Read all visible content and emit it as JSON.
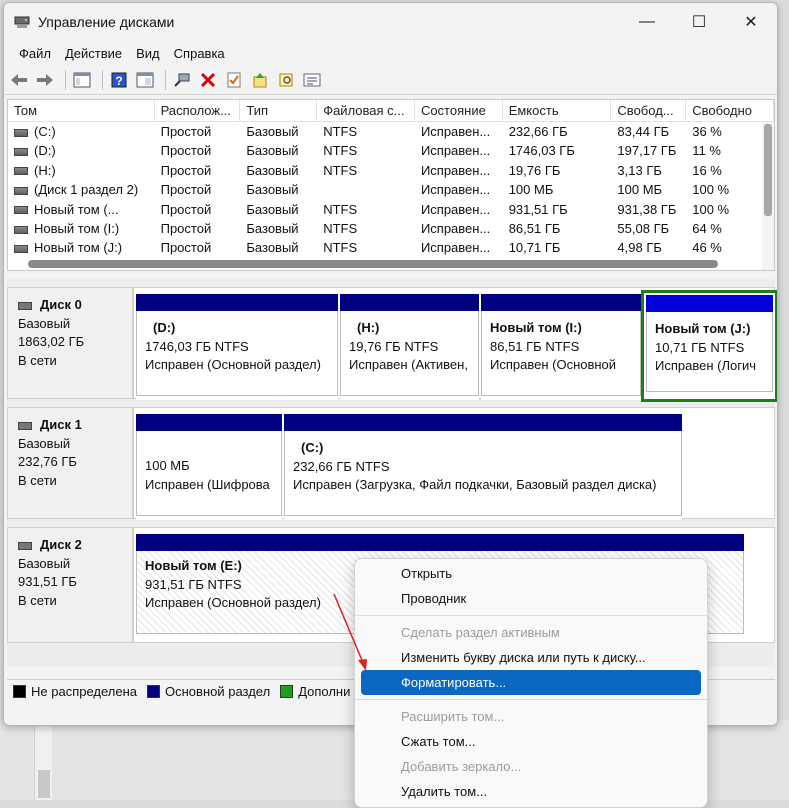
{
  "window": {
    "title": "Управление дисками"
  },
  "menu": [
    "Файл",
    "Действие",
    "Вид",
    "Справка"
  ],
  "columns": [
    "Том",
    "Располож...",
    "Тип",
    "Файловая с...",
    "Состояние",
    "Емкость",
    "Свобод...",
    "Свободно"
  ],
  "volumes": [
    [
      "(C:)",
      "Простой",
      "Базовый",
      "NTFS",
      "Исправен...",
      "232,66 ГБ",
      "83,44 ГБ",
      "36 %"
    ],
    [
      "(D:)",
      "Простой",
      "Базовый",
      "NTFS",
      "Исправен...",
      "1746,03 ГБ",
      "197,17 ГБ",
      "11 %"
    ],
    [
      "(H:)",
      "Простой",
      "Базовый",
      "NTFS",
      "Исправен...",
      "19,76 ГБ",
      "3,13 ГБ",
      "16 %"
    ],
    [
      "(Диск 1 раздел 2)",
      "Простой",
      "Базовый",
      "",
      "Исправен...",
      "100 МБ",
      "100 МБ",
      "100 %"
    ],
    [
      "Новый том (...",
      "Простой",
      "Базовый",
      "NTFS",
      "Исправен...",
      "931,51 ГБ",
      "931,38 ГБ",
      "100 %"
    ],
    [
      "Новый том (I:)",
      "Простой",
      "Базовый",
      "NTFS",
      "Исправен...",
      "86,51 ГБ",
      "55,08 ГБ",
      "64 %"
    ],
    [
      "Новый том (J:)",
      "Простой",
      "Базовый",
      "NTFS",
      "Исправен...",
      "10,71 ГБ",
      "4,98 ГБ",
      "46 %"
    ]
  ],
  "disks": [
    {
      "name": "Диск 0",
      "type": "Базовый",
      "size": "1863,02 ГБ",
      "status": "В сети",
      "parts": [
        {
          "name": "(D:)",
          "size": "1746,03 ГБ NTFS",
          "status": "Исправен (Основной раздел)"
        },
        {
          "name": "(H:)",
          "size": "19,76 ГБ NTFS",
          "status": "Исправен (Активен,"
        },
        {
          "name": "Новый том  (I:)",
          "size": "86,51 ГБ NTFS",
          "status": "Исправен (Основной"
        },
        {
          "name": "Новый том  (J:)",
          "size": "10,71 ГБ NTFS",
          "status": "Исправен (Логич"
        }
      ]
    },
    {
      "name": "Диск 1",
      "type": "Базовый",
      "size": "232,76 ГБ",
      "status": "В сети",
      "parts": [
        {
          "name": "",
          "size": "100 МБ",
          "status": "Исправен (Шифрова"
        },
        {
          "name": "(C:)",
          "size": "232,66 ГБ NTFS",
          "status": "Исправен (Загрузка, Файл подкачки, Базовый раздел диска)"
        }
      ]
    },
    {
      "name": "Диск 2",
      "type": "Базовый",
      "size": "931,51 ГБ",
      "status": "В сети",
      "parts": [
        {
          "name": "Новый том  (E:)",
          "size": "931,51 ГБ NTFS",
          "status": "Исправен (Основной раздел)"
        }
      ]
    }
  ],
  "legend": [
    {
      "label": "Не распределена",
      "color": "#000000"
    },
    {
      "label": "Основной раздел",
      "color": "#000080"
    },
    {
      "label": "Дополни",
      "color": "#1e9e1e"
    }
  ],
  "context_menu": [
    {
      "label": "Открыть",
      "disabled": false
    },
    {
      "label": "Проводник",
      "disabled": false
    },
    {
      "label": "Сделать раздел активным",
      "disabled": true
    },
    {
      "label": "Изменить букву диска или путь к диску...",
      "disabled": false
    },
    {
      "label": "Форматировать...",
      "disabled": false,
      "highlighted": true
    },
    {
      "label": "Расширить том...",
      "disabled": true
    },
    {
      "label": "Сжать том...",
      "disabled": false
    },
    {
      "label": "Добавить зеркало...",
      "disabled": true
    },
    {
      "label": "Удалить том...",
      "disabled": false
    }
  ],
  "colors": {
    "primary_partition": "#000080",
    "selected_outline": "#1e7e1e",
    "menu_highlight": "#0b67c2",
    "arrow": "#e02020"
  }
}
